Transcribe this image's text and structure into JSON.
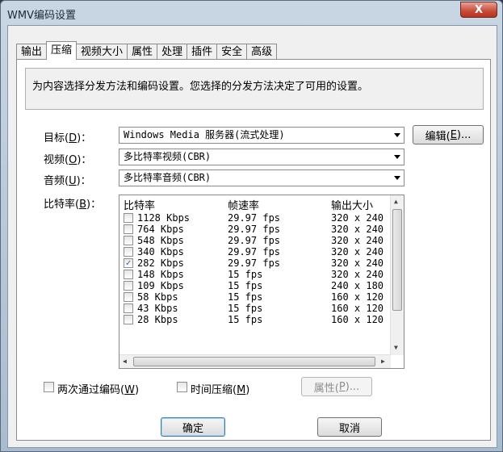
{
  "window": {
    "title": "WMV编码设置",
    "close_glyph": "X"
  },
  "tabs": [
    "输出",
    "压缩",
    "视频大小",
    "属性",
    "处理",
    "插件",
    "安全",
    "高级"
  ],
  "active_tab": "压缩",
  "info_text": "为内容选择分发方法和编码设置。您选择的分发方法决定了可用的设置。",
  "target": {
    "label": "目标(",
    "key": "D",
    "suffix": ")：",
    "value": "Windows Media 服务器(流式处理)"
  },
  "edit_button": {
    "label": "编辑(",
    "key": "E",
    "suffix": ")..."
  },
  "video": {
    "label": "视频(",
    "key": "O",
    "suffix": ")：",
    "value": "多比特率视频(CBR)"
  },
  "audio": {
    "label": "音频(",
    "key": "U",
    "suffix": ")：",
    "value": "多比特率音频(CBR)"
  },
  "bitrate": {
    "label": "比特率(",
    "key": "B",
    "suffix": ")："
  },
  "bitrate_list": {
    "headers": [
      "比特率",
      "帧速率",
      "输出大小"
    ],
    "rows": [
      {
        "checked": false,
        "bitrate": "1128 Kbps",
        "fps": "29.97 fps",
        "size": "320 x 240"
      },
      {
        "checked": false,
        "bitrate": "764 Kbps",
        "fps": "29.97 fps",
        "size": "320 x 240"
      },
      {
        "checked": false,
        "bitrate": "548 Kbps",
        "fps": "29.97 fps",
        "size": "320 x 240"
      },
      {
        "checked": false,
        "bitrate": "340 Kbps",
        "fps": "29.97 fps",
        "size": "320 x 240"
      },
      {
        "checked": true,
        "bitrate": "282 Kbps",
        "fps": "29.97 fps",
        "size": "320 x 240"
      },
      {
        "checked": false,
        "bitrate": "148 Kbps",
        "fps": "15 fps",
        "size": "320 x 240"
      },
      {
        "checked": false,
        "bitrate": "109 Kbps",
        "fps": "15 fps",
        "size": "240 x 180"
      },
      {
        "checked": false,
        "bitrate": "58 Kbps",
        "fps": "15 fps",
        "size": "160 x 120"
      },
      {
        "checked": false,
        "bitrate": "43 Kbps",
        "fps": "15 fps",
        "size": "160 x 120"
      },
      {
        "checked": false,
        "bitrate": "28 Kbps",
        "fps": "15 fps",
        "size": "160 x 120"
      }
    ],
    "check_glyph": "✓"
  },
  "two_pass": {
    "label": "两次通过编码(",
    "key": "W",
    "suffix": ")",
    "checked": false
  },
  "time_compress": {
    "label": "时间压缩(",
    "key": "M",
    "suffix": ")",
    "checked": false
  },
  "properties_button": {
    "label": "属性(",
    "key": "P",
    "suffix": ")...",
    "enabled": false
  },
  "ok_button": "确定",
  "cancel_button": "取消",
  "icons": {
    "scroll_up": "▲",
    "scroll_down": "▼",
    "scroll_left": "◀",
    "scroll_right": "▶",
    "combo_arrow": "chevron-down-icon"
  }
}
